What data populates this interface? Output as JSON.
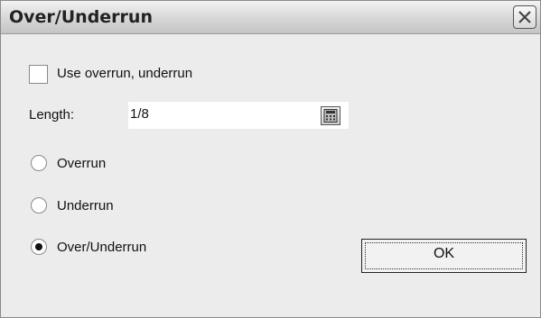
{
  "window": {
    "title": "Over/Underrun"
  },
  "use_option": {
    "label": "Use overrun, underrun",
    "checked": false
  },
  "length": {
    "label": "Length:",
    "value": "1/8",
    "calculator_icon": "calculator-icon"
  },
  "options": [
    {
      "label": "Overrun",
      "selected": false
    },
    {
      "label": "Underrun",
      "selected": false
    },
    {
      "label": "Over/Underrun",
      "selected": true
    }
  ],
  "buttons": {
    "ok_label": "OK"
  },
  "icons": {
    "close": "close-icon"
  }
}
